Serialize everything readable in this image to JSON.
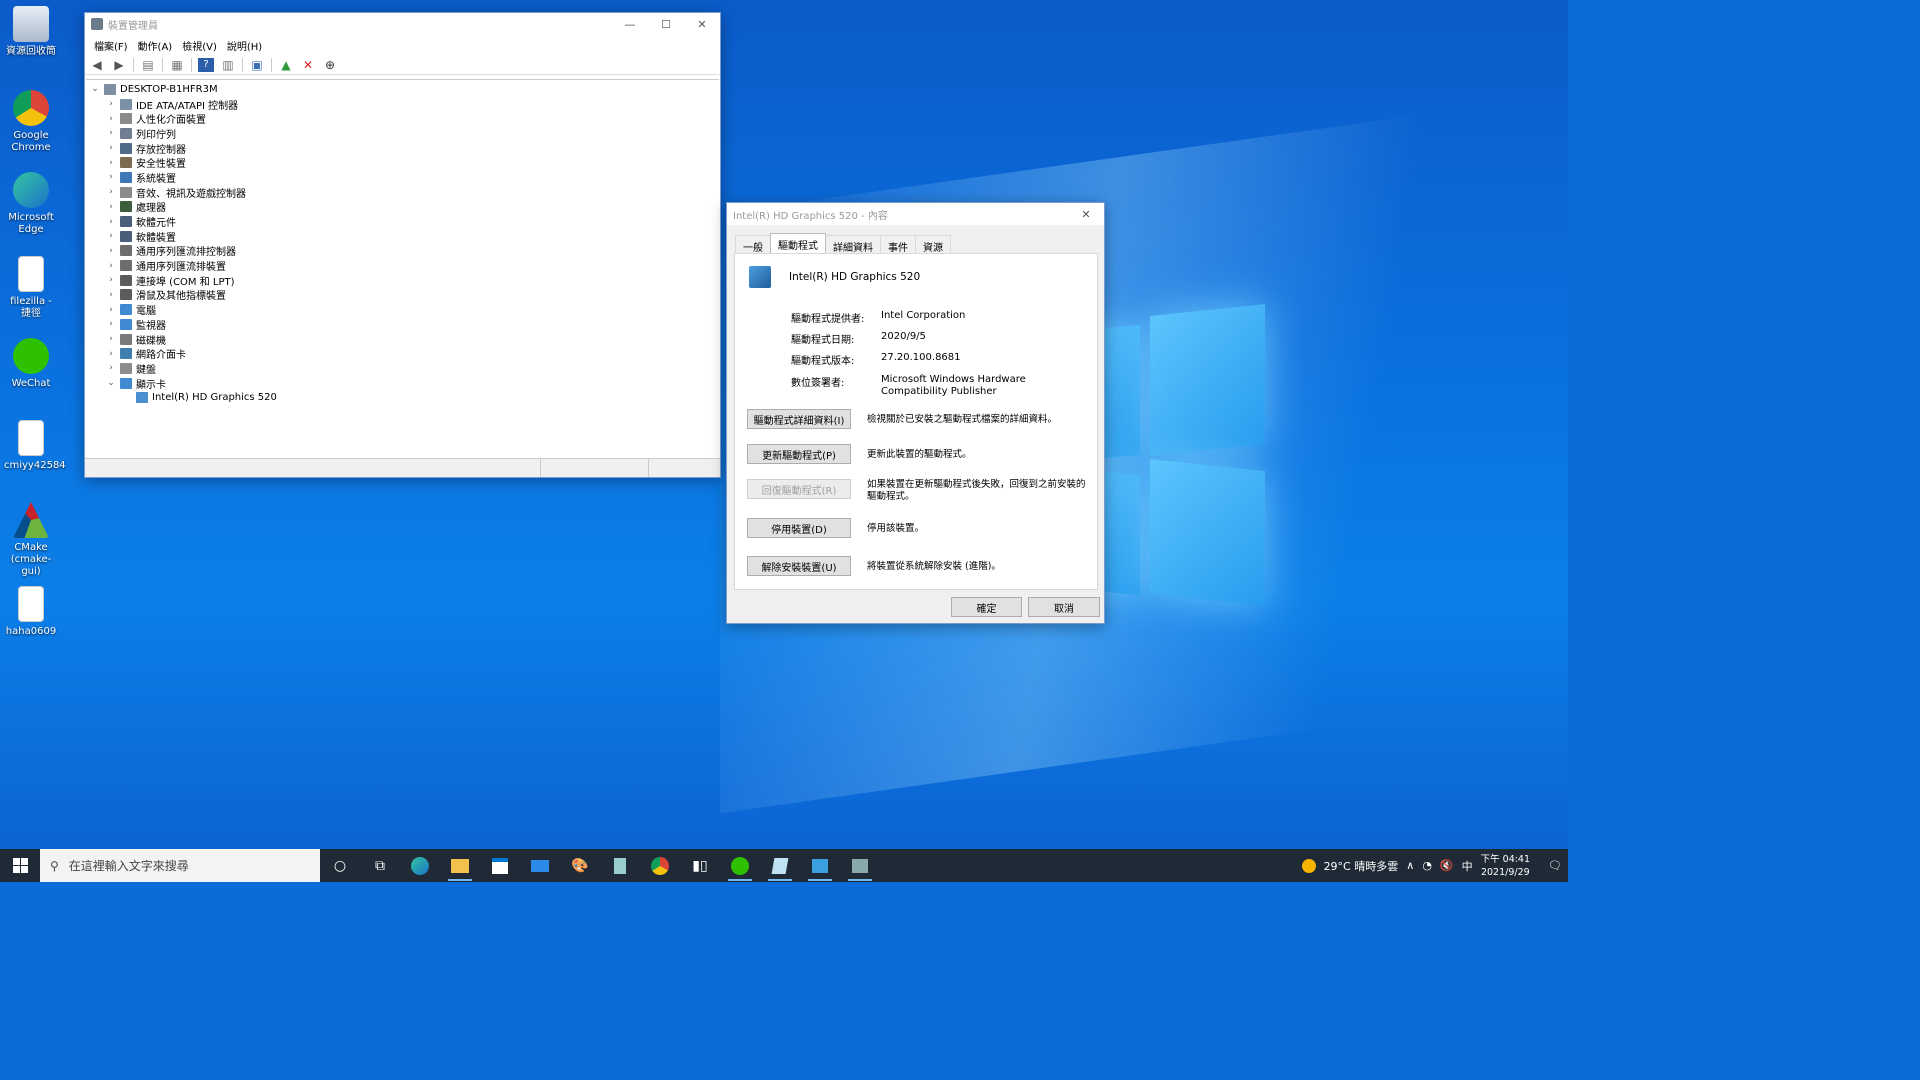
{
  "desktop": {
    "icons": [
      {
        "label": "資源回收筒",
        "icon": "recycle-bin-icon"
      },
      {
        "label": "Google Chrome",
        "icon": "chrome-icon"
      },
      {
        "label": "Microsoft Edge",
        "icon": "edge-icon"
      },
      {
        "label": "filezilla - 捷徑",
        "icon": "file-icon"
      },
      {
        "label": "WeChat",
        "icon": "wechat-icon"
      },
      {
        "label": "cmiyy42584",
        "icon": "file-icon"
      },
      {
        "label": "CMake (cmake-gui)",
        "icon": "cmake-icon"
      },
      {
        "label": "haha0609",
        "icon": "file-icon"
      }
    ]
  },
  "devmgr": {
    "title": "裝置管理員",
    "menu": [
      "檔案(F)",
      "動作(A)",
      "檢視(V)",
      "說明(H)"
    ],
    "root": "DESKTOP-B1HFR3M",
    "categories": [
      "IDE ATA/ATAPI 控制器",
      "人性化介面裝置",
      "列印佇列",
      "存放控制器",
      "安全性裝置",
      "系統裝置",
      "音效、視訊及遊戲控制器",
      "處理器",
      "軟體元件",
      "軟體裝置",
      "通用序列匯流排控制器",
      "通用序列匯流排裝置",
      "連接埠 (COM 和 LPT)",
      "滑鼠及其他指標裝置",
      "電腦",
      "監視器",
      "磁碟機",
      "網路介面卡",
      "鍵盤",
      "顯示卡"
    ],
    "child": "Intel(R) HD Graphics 520"
  },
  "props": {
    "title": "Intel(R) HD Graphics 520 - 內容",
    "tabs": [
      "一般",
      "驅動程式",
      "詳細資料",
      "事件",
      "資源"
    ],
    "device_name": "Intel(R) HD Graphics 520",
    "provider_label": "驅動程式提供者:",
    "provider": "Intel Corporation",
    "date_label": "驅動程式日期:",
    "date": "2020/9/5",
    "version_label": "驅動程式版本:",
    "version": "27.20.100.8681",
    "signer_label": "數位簽署者:",
    "signer": "Microsoft Windows Hardware Compatibility Publisher",
    "buttons": [
      {
        "label": "驅動程式詳細資料(I)",
        "desc": "檢視關於已安裝之驅動程式檔案的詳細資料。"
      },
      {
        "label": "更新驅動程式(P)",
        "desc": "更新此裝置的驅動程式。"
      },
      {
        "label": "回復驅動程式(R)",
        "desc": "如果裝置在更新驅動程式後失敗，回復到之前安裝的驅動程式。"
      },
      {
        "label": "停用裝置(D)",
        "desc": "停用該裝置。"
      },
      {
        "label": "解除安裝裝置(U)",
        "desc": "將裝置從系統解除安裝 (進階)。"
      }
    ],
    "ok": "確定",
    "cancel": "取消"
  },
  "taskbar": {
    "search_placeholder": "在這裡輸入文字來搜尋",
    "weather": "29°C  晴時多雲",
    "ime": "中",
    "time": "下午 04:41",
    "date": "2021/9/29"
  }
}
